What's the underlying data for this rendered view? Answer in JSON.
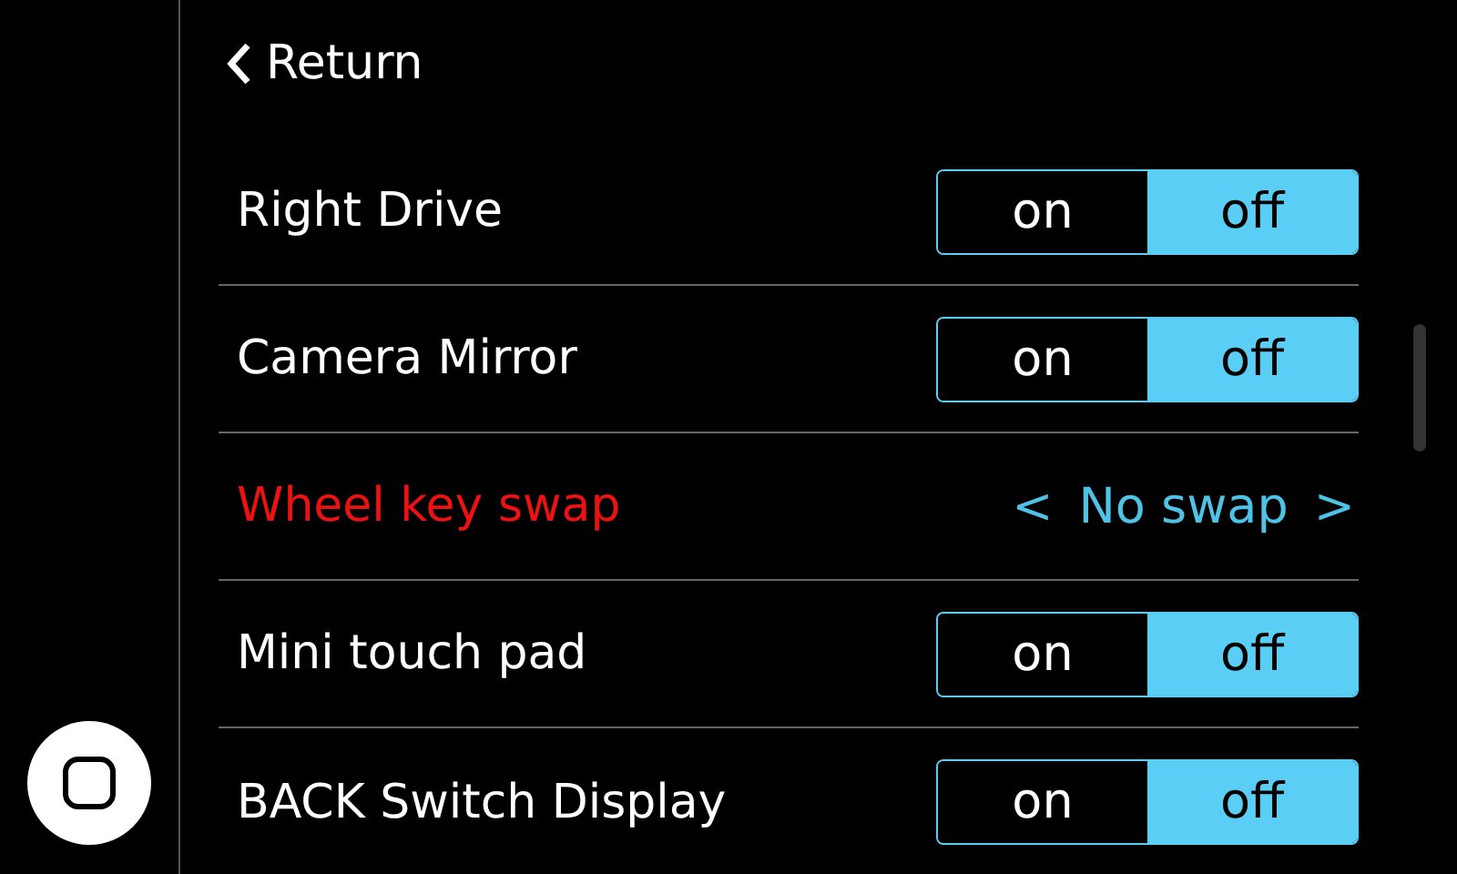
{
  "header": {
    "back_label": "Return"
  },
  "rows": [
    {
      "kind": "toggle",
      "label": "Right Drive",
      "selected": false,
      "options": [
        {
          "label": "on",
          "selected": false
        },
        {
          "label": "off",
          "selected": true
        }
      ]
    },
    {
      "kind": "toggle",
      "label": "Camera Mirror",
      "selected": false,
      "options": [
        {
          "label": "on",
          "selected": false
        },
        {
          "label": "off",
          "selected": true
        }
      ]
    },
    {
      "kind": "selector",
      "label": "Wheel key swap",
      "selected": true,
      "prev": "<",
      "value": "No swap",
      "next": ">"
    },
    {
      "kind": "toggle",
      "label": "Mini touch pad",
      "selected": false,
      "options": [
        {
          "label": "on",
          "selected": false
        },
        {
          "label": "off",
          "selected": true
        }
      ]
    },
    {
      "kind": "toggle",
      "label": "BACK Switch Display",
      "selected": false,
      "options": [
        {
          "label": "on",
          "selected": false
        },
        {
          "label": "off",
          "selected": true
        }
      ]
    }
  ]
}
